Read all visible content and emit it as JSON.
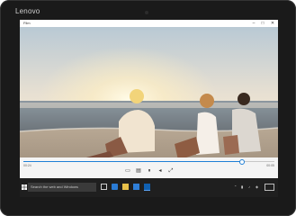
{
  "device": {
    "brand": "Lenovo"
  },
  "window": {
    "title": "Film",
    "minimize_glyph": "–",
    "maximize_glyph": "□",
    "close_glyph": "✕"
  },
  "player": {
    "elapsed": "00:24",
    "remaining": "00:05",
    "progress": 0.87,
    "controls": [
      {
        "name": "subtitles-icon",
        "glyph": "▭"
      },
      {
        "name": "playlist-icon",
        "glyph": "▤"
      },
      {
        "name": "pause-icon",
        "glyph": "⏸"
      },
      {
        "name": "volume-icon",
        "glyph": "◂"
      },
      {
        "name": "fullscreen-icon",
        "glyph": "⤢"
      }
    ]
  },
  "taskbar": {
    "search_placeholder": "Search the web and Windows",
    "apps": [
      "task-view-icon",
      "edge-icon",
      "file-explorer-icon",
      "store-icon",
      "movies-app-icon"
    ],
    "tray": [
      "⌃",
      "▮",
      "♪",
      "◈"
    ]
  },
  "colors": {
    "accent": "#1e7fd6",
    "taskbar": "#1f1f1f",
    "bezel": "#1a1a1a"
  }
}
